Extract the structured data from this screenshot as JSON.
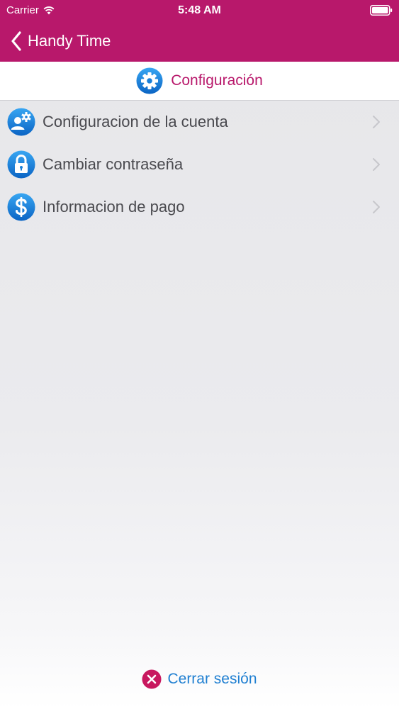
{
  "status_bar": {
    "carrier": "Carrier",
    "time": "5:48 AM"
  },
  "nav": {
    "back_label": "Handy Time"
  },
  "header": {
    "title": "Configuración",
    "icon": "gear-icon"
  },
  "menu": {
    "items": [
      {
        "label": "Configuracion de la cuenta",
        "icon": "user-settings-icon"
      },
      {
        "label": "Cambiar contraseña",
        "icon": "lock-icon"
      },
      {
        "label": "Informacion de pago",
        "icon": "dollar-icon"
      }
    ]
  },
  "footer": {
    "logout_label": "Cerrar sesión",
    "icon": "close-circle-icon"
  },
  "colors": {
    "brand": "#b8186b",
    "accent_blue": "#1f7fd1",
    "text": "#4a4a4f"
  }
}
